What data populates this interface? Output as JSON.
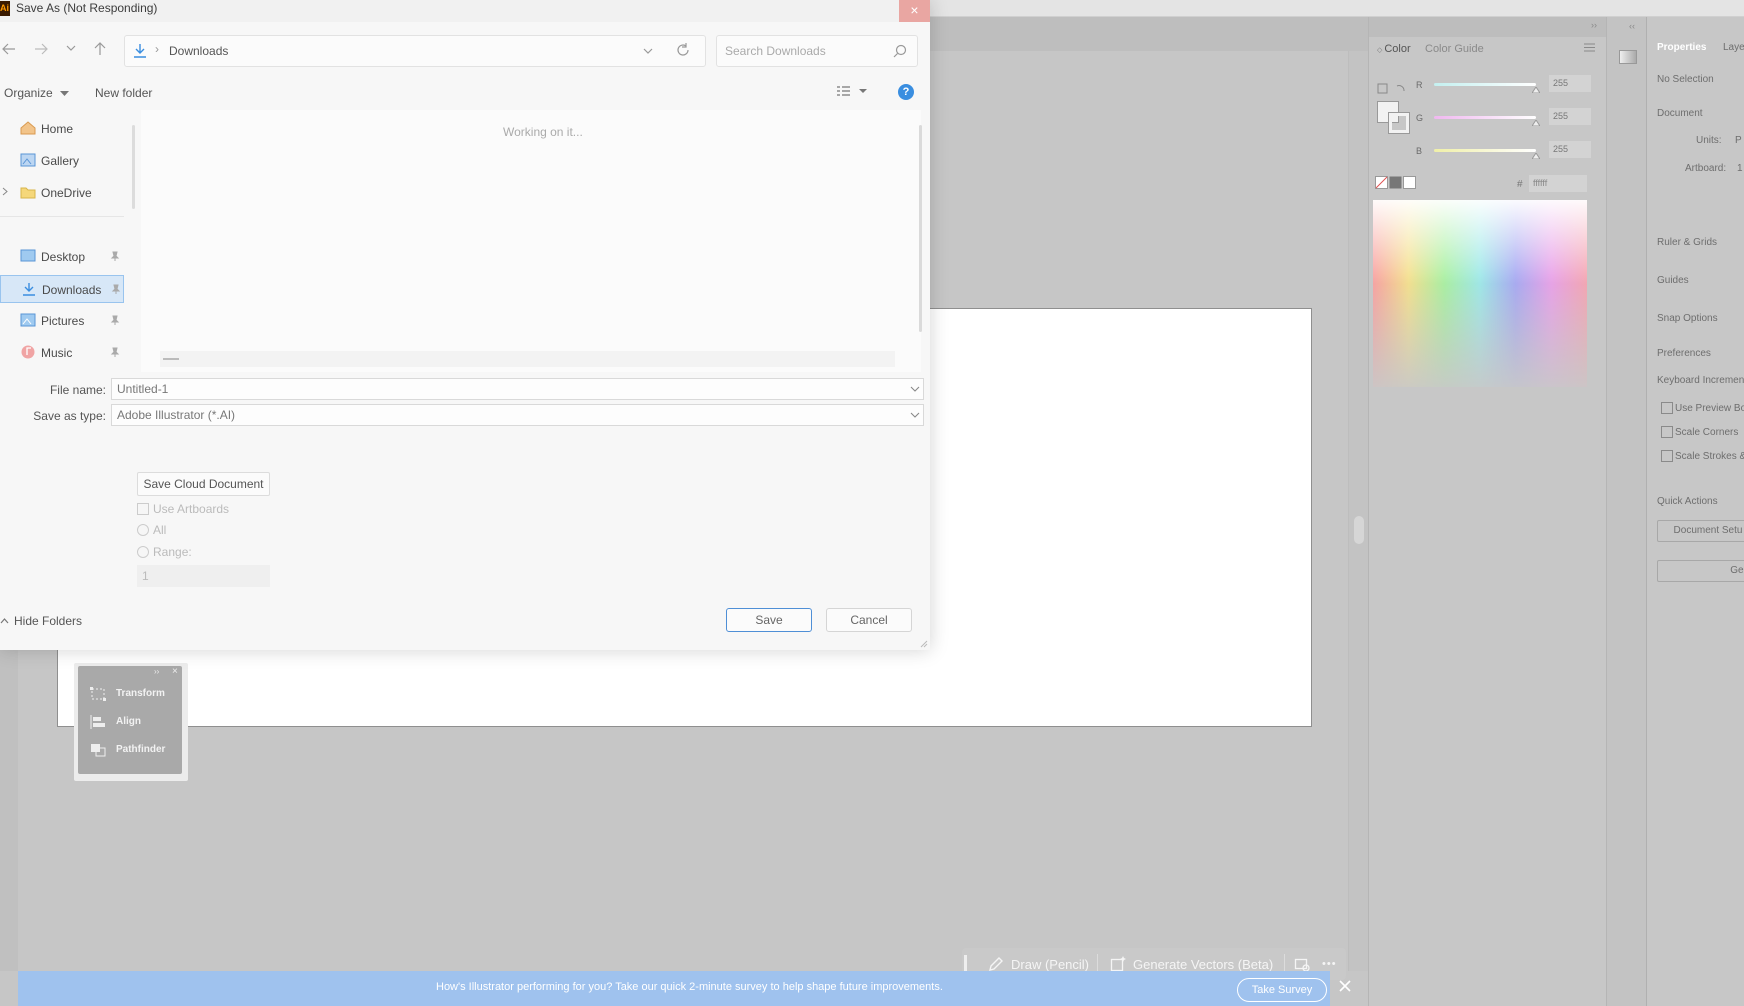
{
  "dialog": {
    "title": "Save As (Not Responding)",
    "app_logo": "Ai",
    "close_icon": "×",
    "address": {
      "location": "Downloads",
      "separator": "›"
    },
    "search": {
      "placeholder": "Search Downloads"
    },
    "toolbar": {
      "organize": "Organize",
      "new_folder": "New folder",
      "help": "?"
    },
    "nav": {
      "home": "Home",
      "gallery": "Gallery",
      "onedrive": "OneDrive",
      "desktop": "Desktop",
      "downloads": "Downloads",
      "pictures": "Pictures",
      "music": "Music"
    },
    "content": {
      "status": "Working on it..."
    },
    "file_name": {
      "label": "File name:",
      "value": "Untitled-1"
    },
    "save_type": {
      "label": "Save as type:",
      "value": "Adobe Illustrator (*.AI)"
    },
    "options": {
      "cloud_button": "Save Cloud Document",
      "use_artboards": "Use Artboards",
      "all": "All",
      "range": "Range:",
      "range_value": "1"
    },
    "hide_folders": "Hide Folders",
    "save": "Save",
    "cancel": "Cancel"
  },
  "color_panel": {
    "tabs": [
      "Color",
      "Color Guide"
    ],
    "channels": [
      {
        "name": "R",
        "value": "255"
      },
      {
        "name": "G",
        "value": "255"
      },
      {
        "name": "B",
        "value": "255"
      }
    ],
    "hex_label": "#",
    "hex_value": "ffffff"
  },
  "properties_panel": {
    "tabs": [
      "Properties",
      "Layers"
    ],
    "no_selection": "No Selection",
    "document": "Document",
    "units_label": "Units:",
    "units_value": "P",
    "artboard_label": "Artboard:",
    "artboard_value": "1",
    "ruler_grids": "Ruler & Grids",
    "guides": "Guides",
    "snap_options": "Snap Options",
    "preferences": "Preferences",
    "keyboard_increment": "Keyboard Increment",
    "use_preview_bounds": "Use Preview Bo",
    "scale_corners": "Scale Corners",
    "scale_strokes": "Scale Strokes &",
    "quick_actions": "Quick Actions",
    "document_setup": "Document Setu",
    "generate": "Gener"
  },
  "float_panel": {
    "items": [
      "Transform",
      "Align",
      "Pathfinder"
    ]
  },
  "context_bar": {
    "draw": "Draw (Pencil)",
    "generate": "Generate Vectors (Beta)",
    "more": "•••"
  },
  "survey": {
    "text": "How's Illustrator performing for you? Take our quick 2-minute survey to help shape future improvements.",
    "button": "Take Survey"
  },
  "colors": {
    "accent": "#4f8fd6",
    "survey_banner": "#9fc2ee",
    "close_hover": "#e9a6a2"
  }
}
